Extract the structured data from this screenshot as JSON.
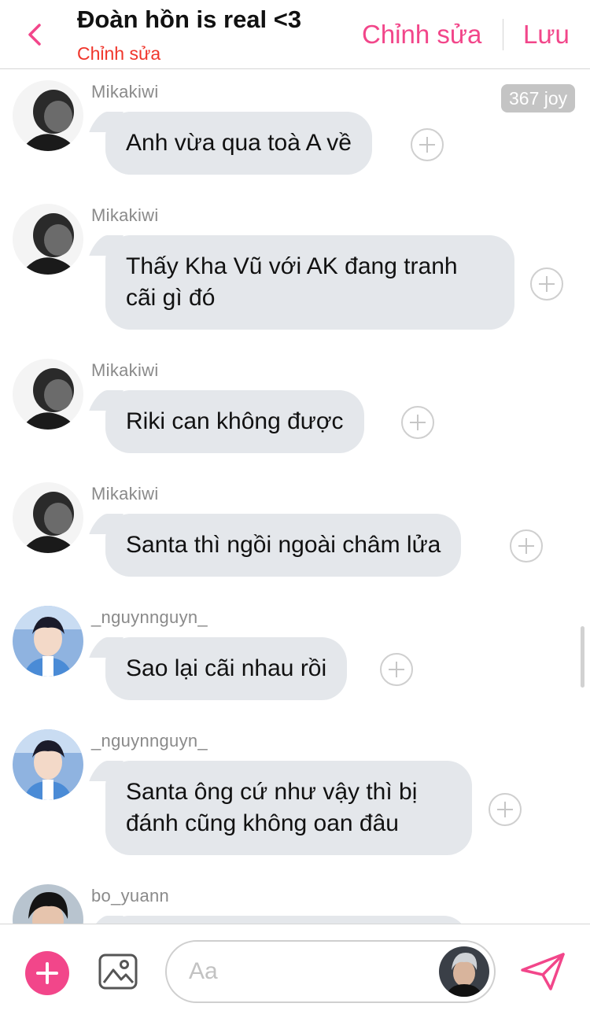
{
  "header": {
    "title": "Đoàn hồn is real <3",
    "subtitle": "Chỉnh sửa",
    "edit_label": "Chỉnh sửa",
    "save_label": "Lưu",
    "back_icon": "chevron-left-icon",
    "accent_color": "#f2468a",
    "subtitle_color": "#f0352b"
  },
  "joy_badge": "367 joy",
  "messages": [
    {
      "sender": "Mikakiwi",
      "text": "Anh vừa qua toà A về",
      "avatar": "bw-profile"
    },
    {
      "sender": "Mikakiwi",
      "text": "Thấy Kha Vũ với AK đang tranh\ncãi gì đó",
      "avatar": "bw-profile"
    },
    {
      "sender": "Mikakiwi",
      "text": "Riki can không được",
      "avatar": "bw-profile"
    },
    {
      "sender": "Mikakiwi",
      "text": "Santa thì ngồi ngoài châm lửa",
      "avatar": "bw-profile"
    },
    {
      "sender": "_nguynnguyn_",
      "text": "Sao lại cãi nhau rồi",
      "avatar": "boy-blue-shirt"
    },
    {
      "sender": "_nguynnguyn_",
      "text": "Santa ông cứ như vậy thì bị\nđánh cũng không oan đâu",
      "avatar": "boy-blue-shirt"
    },
    {
      "sender": "bo_yuann",
      "text": "",
      "avatar": "boy-dark-hair"
    }
  ],
  "composer": {
    "placeholder": "Aa",
    "value": "",
    "add_icon": "plus-circle-icon",
    "image_icon": "image-icon",
    "send_icon": "send-icon"
  },
  "colors": {
    "bubble": "#e4e7eb",
    "accent": "#f2468a"
  }
}
